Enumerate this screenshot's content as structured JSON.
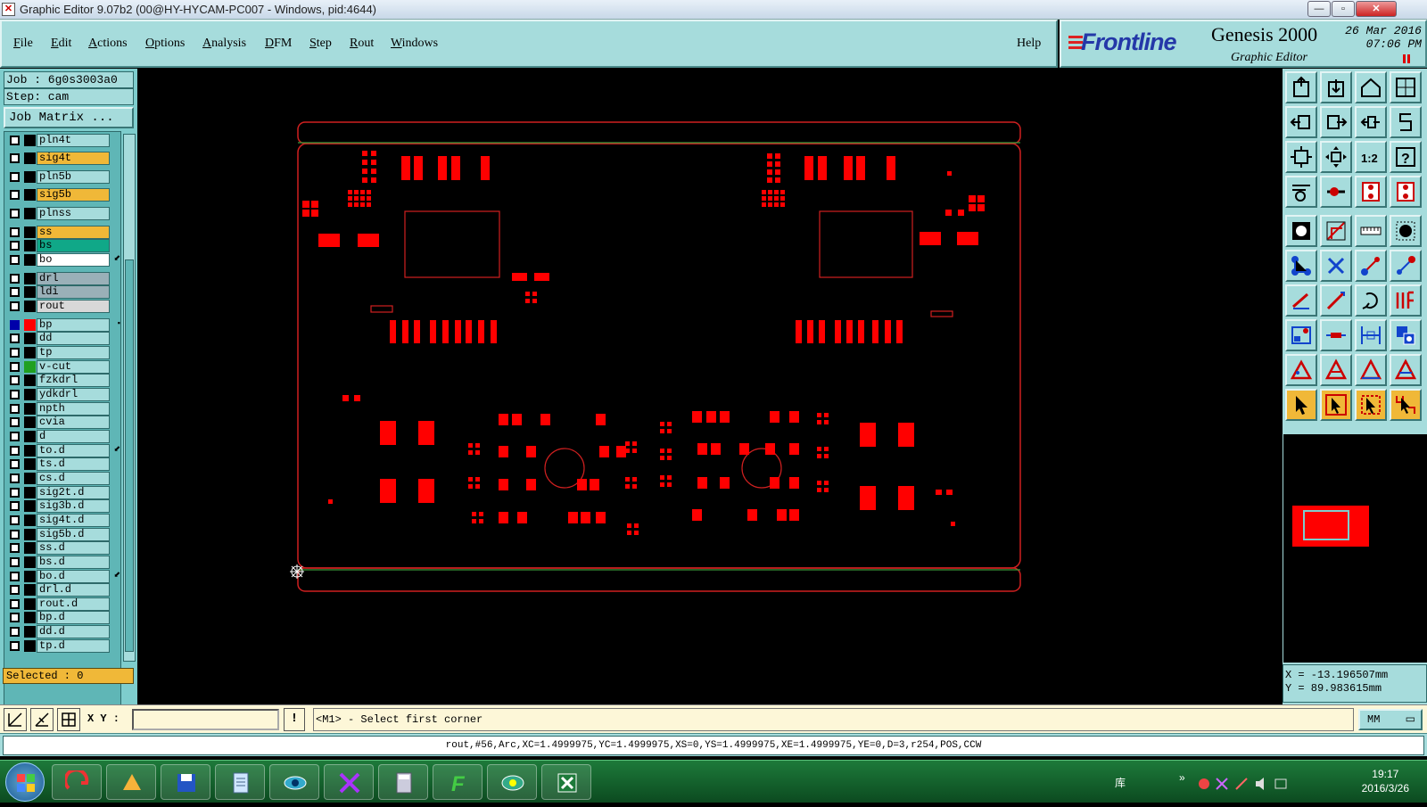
{
  "window": {
    "title": "Graphic Editor 9.07b2 (00@HY-HYCAM-PC007 - Windows, pid:4644)",
    "minimize": "—",
    "maximize": "▫",
    "close": "✕"
  },
  "menu": {
    "items": [
      {
        "label": "File",
        "mnemonic": "F",
        "rest": "ile"
      },
      {
        "label": "Edit",
        "mnemonic": "E",
        "rest": "dit"
      },
      {
        "label": "Actions",
        "mnemonic": "A",
        "rest": "ctions"
      },
      {
        "label": "Options",
        "mnemonic": "O",
        "rest": "ptions"
      },
      {
        "label": "Analysis",
        "mnemonic": "A",
        "rest": "nalysis"
      },
      {
        "label": "DFM",
        "mnemonic": "D",
        "rest": "FM"
      },
      {
        "label": "Step",
        "mnemonic": "S",
        "rest": "tep"
      },
      {
        "label": "Rout",
        "mnemonic": "R",
        "rest": "out"
      },
      {
        "label": "Windows",
        "mnemonic": "W",
        "rest": "indows"
      }
    ],
    "help": "Help"
  },
  "brand": {
    "logo": "Frontline",
    "product": "Genesis 2000",
    "subtitle": "Graphic Editor",
    "date": "26 Mar 2016",
    "time": "07:06 PM"
  },
  "job": {
    "job_label": "Job : 6g0s3003a0",
    "step_label": "Step: cam",
    "matrix_button": "Job Matrix ..."
  },
  "layers": [
    {
      "name": "pln4t",
      "color": "#a6dcdc",
      "swatch": "#000000",
      "checked": false
    },
    {
      "name": "sig4t",
      "color": "#f0b838",
      "swatch": "#000000",
      "checked": false
    },
    {
      "name": "pln5b",
      "color": "#a6dcdc",
      "swatch": "#000000",
      "checked": false
    },
    {
      "name": "sig5b",
      "color": "#f0b838",
      "swatch": "#000000",
      "checked": false
    },
    {
      "name": "plnss",
      "color": "#a6dcdc",
      "swatch": "#000000",
      "checked": false
    },
    {
      "name": "ss",
      "color": "#f0b838",
      "swatch": "#000000",
      "checked": false
    },
    {
      "name": "bs",
      "color": "#10a888",
      "swatch": "#000000",
      "checked": false
    },
    {
      "name": "bo",
      "color": "#ffffff",
      "swatch": "#000000",
      "checked": false,
      "mark": "⬋"
    },
    {
      "name": "drl",
      "color": "#9ab0b8",
      "swatch": "#000000",
      "checked": false
    },
    {
      "name": "ldi",
      "color": "#9ab0b8",
      "swatch": "#000000",
      "checked": false
    },
    {
      "name": "rout",
      "color": "#d8d8d8",
      "swatch": "#000000",
      "checked": false
    },
    {
      "name": "bp",
      "color": "#a6dcdc",
      "swatch": "#ff0000",
      "checked": true,
      "mark": "▪"
    },
    {
      "name": "dd",
      "color": "#a6dcdc",
      "swatch": "#000000",
      "checked": false
    },
    {
      "name": "tp",
      "color": "#a6dcdc",
      "swatch": "#000000",
      "checked": false
    },
    {
      "name": "v-cut",
      "color": "#a6dcdc",
      "swatch": "#20a020",
      "checked": false
    },
    {
      "name": "fzkdrl",
      "color": "#a6dcdc",
      "swatch": "#000000",
      "checked": false
    },
    {
      "name": "ydkdrl",
      "color": "#a6dcdc",
      "swatch": "#000000",
      "checked": false
    },
    {
      "name": "npth",
      "color": "#a6dcdc",
      "swatch": "#000000",
      "checked": false
    },
    {
      "name": "cvia",
      "color": "#a6dcdc",
      "swatch": "#000000",
      "checked": false
    },
    {
      "name": "d",
      "color": "#a6dcdc",
      "swatch": "#000000",
      "checked": false
    },
    {
      "name": "to.d",
      "color": "#a6dcdc",
      "swatch": "#000000",
      "checked": false,
      "mark": "⬋"
    },
    {
      "name": "ts.d",
      "color": "#a6dcdc",
      "swatch": "#000000",
      "checked": false
    },
    {
      "name": "cs.d",
      "color": "#a6dcdc",
      "swatch": "#000000",
      "checked": false
    },
    {
      "name": "sig2t.d",
      "color": "#a6dcdc",
      "swatch": "#000000",
      "checked": false
    },
    {
      "name": "sig3b.d",
      "color": "#a6dcdc",
      "swatch": "#000000",
      "checked": false
    },
    {
      "name": "sig4t.d",
      "color": "#a6dcdc",
      "swatch": "#000000",
      "checked": false
    },
    {
      "name": "sig5b.d",
      "color": "#a6dcdc",
      "swatch": "#000000",
      "checked": false
    },
    {
      "name": "ss.d",
      "color": "#a6dcdc",
      "swatch": "#000000",
      "checked": false
    },
    {
      "name": "bs.d",
      "color": "#a6dcdc",
      "swatch": "#000000",
      "checked": false
    },
    {
      "name": "bo.d",
      "color": "#a6dcdc",
      "swatch": "#000000",
      "checked": false,
      "mark": "⬋"
    },
    {
      "name": "drl.d",
      "color": "#a6dcdc",
      "swatch": "#000000",
      "checked": false
    },
    {
      "name": "rout.d",
      "color": "#a6dcdc",
      "swatch": "#000000",
      "checked": false
    },
    {
      "name": "bp.d",
      "color": "#a6dcdc",
      "swatch": "#000000",
      "checked": false
    },
    {
      "name": "dd.d",
      "color": "#a6dcdc",
      "swatch": "#000000",
      "checked": false
    },
    {
      "name": "tp.d",
      "color": "#a6dcdc",
      "swatch": "#000000",
      "checked": false
    }
  ],
  "selected": "Selected : 0",
  "coords": {
    "x": "X = -13.196507mm",
    "y": "Y = 89.983615mm"
  },
  "command": {
    "xy_label": "X Y :",
    "xy_value": "",
    "info_button": "!",
    "prompt": "<M1> - Select first corner",
    "units": "MM",
    "units_arrow": "▭"
  },
  "info_line": "rout,#56,Arc,XC=1.4999975,YC=1.4999975,XS=0,YS=1.4999975,XE=1.4999975,YE=0,D=3,r254,POS,CCW",
  "taskbar": {
    "tray_text": "库",
    "time": "19:17",
    "date": "2016/3/26",
    "chevron": "»"
  },
  "colors": {
    "panel": "#a6dcdc",
    "highlight": "#f0b838",
    "pad": "#ff0000",
    "outline": "#d02020",
    "vcut": "#3a9a3a"
  }
}
